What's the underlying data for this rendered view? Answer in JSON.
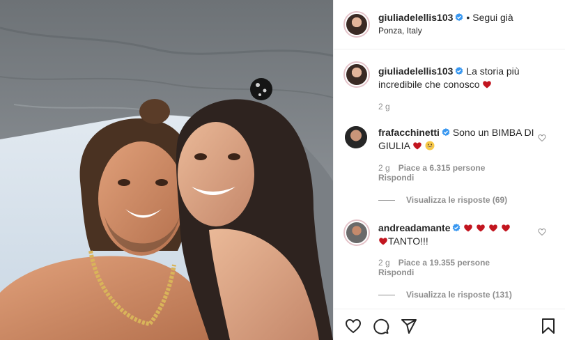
{
  "post": {
    "username": "giuliadelellis103",
    "follow_status": "Segui già",
    "location": "Ponza, Italy",
    "caption_author": "giuliadelellis103",
    "caption_text": "La storia più incredibile che conosco",
    "caption_time": "2 g"
  },
  "comments": [
    {
      "author": "frafacchinetti",
      "text": "Sono un BIMBA DI GIULIA",
      "time": "2 g",
      "likes": "Piace a 6.315 persone",
      "reply": "Rispondi",
      "view_replies": "Visualizza le risposte (69)"
    },
    {
      "author": "andreadamante",
      "text": "TANTO!!!",
      "time": "2 g",
      "likes": "Piace a 19.355 persone",
      "reply": "Rispondi",
      "view_replies": "Visualizza le risposte (131)"
    }
  ],
  "icons": {
    "verified": "verified-badge-icon",
    "like": "heart-icon",
    "comment": "comment-icon",
    "share": "send-icon",
    "save": "bookmark-icon"
  },
  "colors": {
    "verified": "#3897f0",
    "heart_emoji": "#c2151f",
    "secondary_text": "#8e8e8e"
  }
}
